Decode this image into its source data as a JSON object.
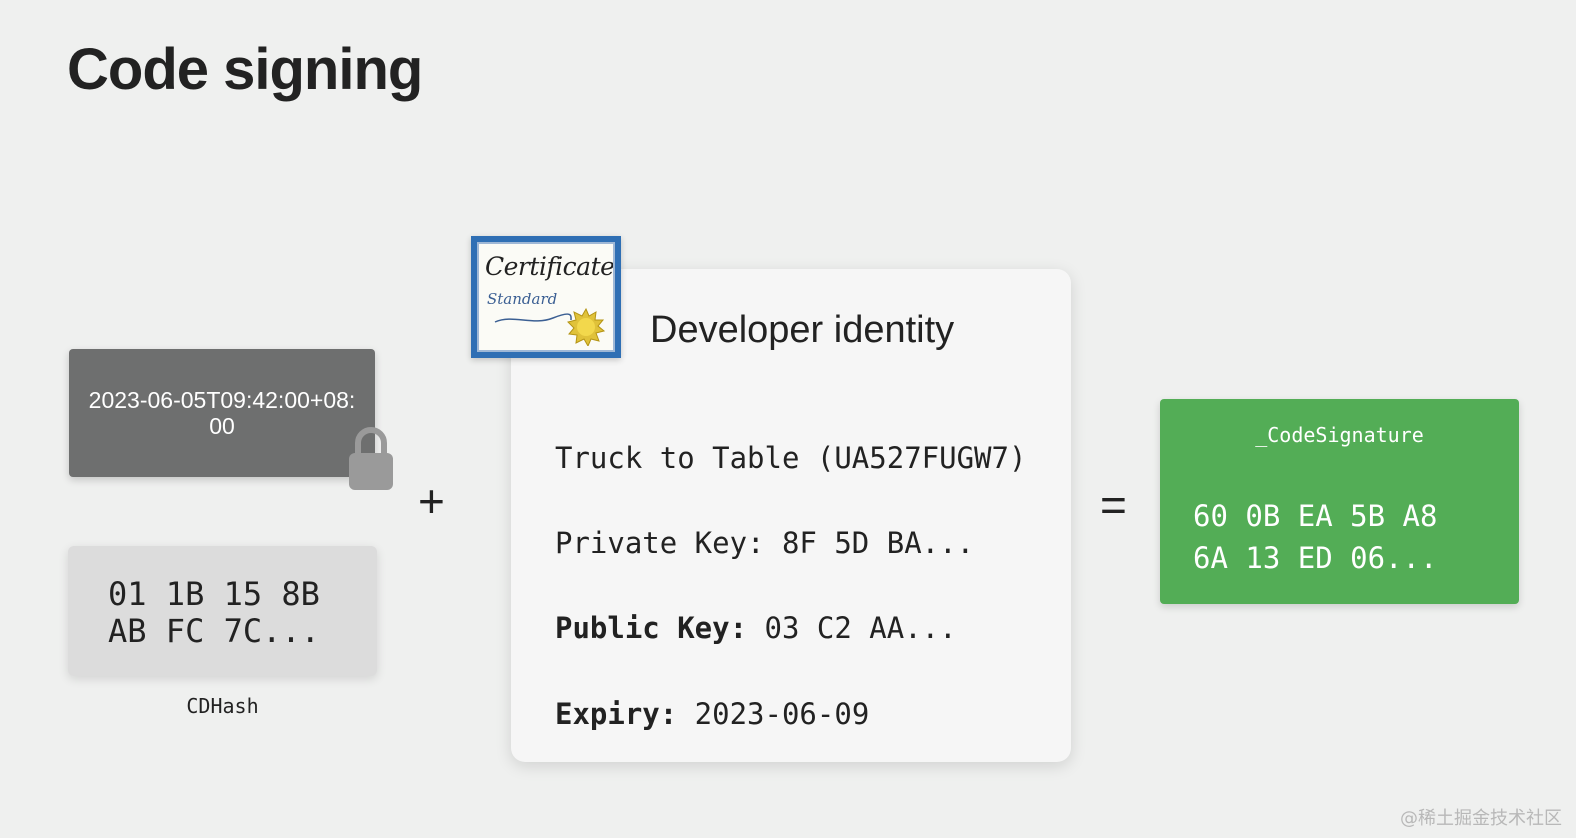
{
  "slide": {
    "title": "Code signing"
  },
  "timestamp": {
    "text": "2023-06-05T09:42:00+08:00"
  },
  "cdhash": {
    "lines": [
      "01 1B 15 8B",
      "AB FC 7C..."
    ],
    "caption": "CDHash"
  },
  "operators": {
    "plus": "+",
    "equals": "="
  },
  "certificate": {
    "title": "Certificate",
    "subtitle": "Standard"
  },
  "identity": {
    "title": "Developer identity",
    "team": "Truck to Table (UA527FUGW7)",
    "private_key": "Private Key: 8F 5D BA...",
    "public_key_label": "Public Key:",
    "public_key_value": " 03 C2 AA...",
    "expiry_label": "Expiry:",
    "expiry_value": " 2023-06-09"
  },
  "signature": {
    "name": "_CodeSignature",
    "lines": [
      "60 0B EA 5B A8",
      "6A 13 ED 06..."
    ]
  },
  "watermark": "@稀土掘金技术社区",
  "colors": {
    "background": "#eff0ef",
    "timestamp_box": "#6e6f6f",
    "cdhash_box": "#dcdcdc",
    "signature_box": "#53ad56",
    "certificate_frame": "#2f6fb4"
  }
}
